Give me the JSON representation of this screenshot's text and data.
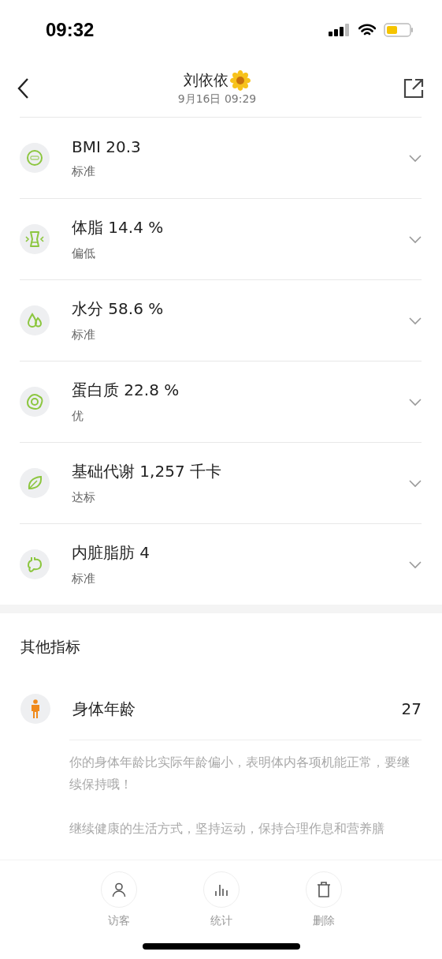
{
  "status_bar": {
    "time": "09:32"
  },
  "header": {
    "title": "刘依依",
    "subtitle": "9月16日 09:29"
  },
  "metrics": [
    {
      "kind": "bmi",
      "title": "BMI 20.3",
      "status": "标准"
    },
    {
      "kind": "fat",
      "title": "体脂 14.4 %",
      "status": "偏低"
    },
    {
      "kind": "water",
      "title": "水分 58.6 %",
      "status": "标准"
    },
    {
      "kind": "protein",
      "title": "蛋白质 22.8 %",
      "status": "优"
    },
    {
      "kind": "metabolism",
      "title": "基础代谢 1,257 千卡",
      "status": "达标"
    },
    {
      "kind": "visceral",
      "title": "内脏脂肪 4",
      "status": "标准"
    }
  ],
  "other": {
    "heading": "其他指标",
    "item": {
      "label": "身体年龄",
      "value": "27"
    },
    "paragraphs": [
      "你的身体年龄比实际年龄偏小，表明体内各项机能正常，要继续保持哦！",
      "继续健康的生活方式，坚持运动，保持合理作息和营养膳"
    ]
  },
  "toolbar": [
    {
      "kind": "visitor",
      "label": "访客"
    },
    {
      "kind": "stats",
      "label": "统计"
    },
    {
      "kind": "delete",
      "label": "删除"
    }
  ]
}
